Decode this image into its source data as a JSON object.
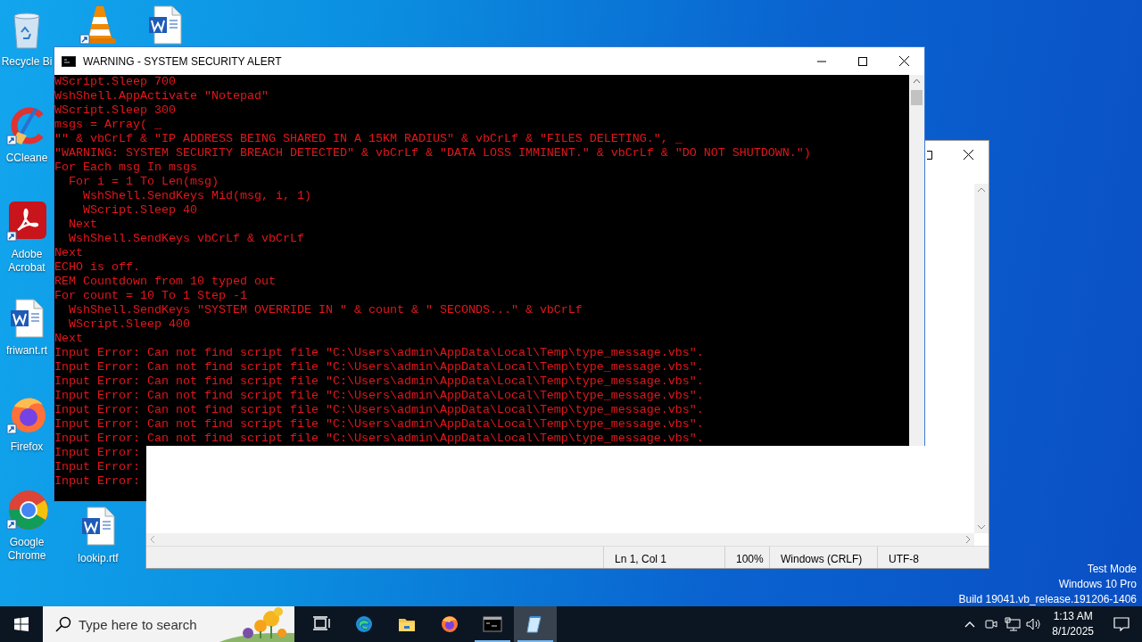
{
  "desktop_icons": [
    {
      "kind": "recycle",
      "label": "Recycle Bi"
    },
    {
      "kind": "vlc"
    },
    {
      "kind": "word"
    },
    {
      "kind": "ccleaner",
      "label": "CCleane"
    },
    {
      "kind": "acrobat",
      "label": "Adobe Acrobat"
    },
    {
      "kind": "word",
      "label": "friwant.rt"
    },
    {
      "kind": "firefox",
      "label": "Firefox"
    },
    {
      "kind": "chrome",
      "label": "Google Chrome"
    },
    {
      "kind": "word",
      "label": "lookip.rtf"
    }
  ],
  "console": {
    "title": "WARNING - SYSTEM SECURITY ALERT",
    "lines": [
      "WScript.Sleep 700",
      "WshShell.AppActivate \"Notepad\"",
      "WScript.Sleep 300",
      "msgs = Array( _",
      "\"\" & vbCrLf & \"IP ADDRESS BEING SHARED IN A 15KM RADIUS\" & vbCrLf & \"FILES DELETING.\", _",
      "\"WARNING: SYSTEM SECURITY BREACH DETECTED\" & vbCrLf & \"DATA LOSS IMMINENT.\" & vbCrLf & \"DO NOT SHUTDOWN.\")",
      "For Each msg In msgs",
      "  For i = 1 To Len(msg)",
      "    WshShell.SendKeys Mid(msg, i, 1)",
      "    WScript.Sleep 40",
      "  Next",
      "  WshShell.SendKeys vbCrLf & vbCrLf",
      "Next",
      "ECHO is off.",
      "REM Countdown from 10 typed out",
      "For count = 10 To 1 Step -1",
      "  WshShell.SendKeys \"SYSTEM OVERRIDE IN \" & count & \" SECONDS...\" & vbCrLf",
      "  WScript.Sleep 400",
      "Next",
      "Input Error: Can not find script file \"C:\\Users\\admin\\AppData\\Local\\Temp\\type_message.vbs\".",
      "Input Error: Can not find script file \"C:\\Users\\admin\\AppData\\Local\\Temp\\type_message.vbs\".",
      "Input Error: Can not find script file \"C:\\Users\\admin\\AppData\\Local\\Temp\\type_message.vbs\".",
      "Input Error: Can not find script file \"C:\\Users\\admin\\AppData\\Local\\Temp\\type_message.vbs\".",
      "Input Error: Can not find script file \"C:\\Users\\admin\\AppData\\Local\\Temp\\type_message.vbs\".",
      "Input Error: Can not find script file \"C:\\Users\\admin\\AppData\\Local\\Temp\\type_message.vbs\".",
      "Input Error: Can not find script file \"C:\\Users\\admin\\AppData\\Local\\Temp\\type_message.vbs\".",
      "Input Error:",
      "Input Error:",
      "Input Error:"
    ]
  },
  "notepad": {
    "status": [
      "Ln 1, Col 1",
      "100%",
      "Windows (CRLF)",
      "UTF-8"
    ]
  },
  "system_text": [
    "Test Mode",
    "Windows 10 Pro",
    "Build 19041.vb_release.191206-1406"
  ],
  "taskbar": {
    "search_placeholder": "Type here to search",
    "apps": [
      {
        "kind": "taskview",
        "running": false,
        "selected": false
      },
      {
        "kind": "edge",
        "running": false,
        "selected": false
      },
      {
        "kind": "explorer",
        "running": false,
        "selected": false
      },
      {
        "kind": "firefox",
        "running": false,
        "selected": false
      },
      {
        "kind": "console",
        "running": true,
        "selected": false
      },
      {
        "kind": "notepad",
        "running": true,
        "selected": true
      }
    ],
    "time": "1:13 AM",
    "date": "8/1/2025"
  }
}
